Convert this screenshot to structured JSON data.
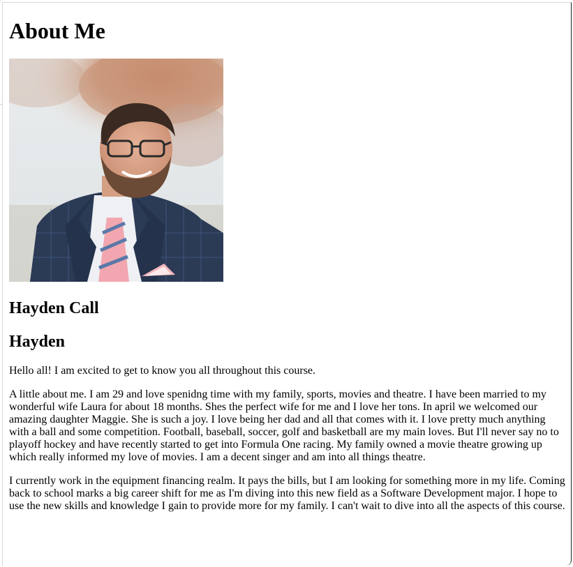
{
  "page": {
    "title": "About Me",
    "portrait_alt": "Portrait photo",
    "name_full": "Hayden Call",
    "name_short": "Hayden",
    "paragraphs": [
      "Hello all! I am excited to get to know you all throughout this course.",
      "A little about me. I am 29 and love spenidng time with my family, sports, movies and theatre. I have been married to my wonderful wife Laura for about 18 months. Shes the perfect wife for me and I love her tons. In april we welcomed our amazing daughter Maggie. She is such a joy. I love being her dad and all that comes with it. I love pretty much anything with a ball and some competition. Football, baseball, soccer, golf and basketball are my main loves. But I'll never say no to playoff hockey and have recently started to get into Formula One racing. My family owned a movie theatre growing up which really informed my love of movies. I am a decent singer and am into all things theatre.",
      "I currently work in the equipment financing realm. It pays the bills, but I am looking for something more in my life. Coming back to school marks a big career shift for me as I'm diving into this new field as a Software Development major. I hope to use the new skills and knowledge I gain to provide more for my family. I can't wait to dive into all the aspects of this course."
    ]
  },
  "colors": {
    "text": "#000000",
    "background": "#ffffff",
    "suit": "#2b3a55",
    "tie_pink": "#f2a7b0",
    "foliage": "#c99073"
  }
}
